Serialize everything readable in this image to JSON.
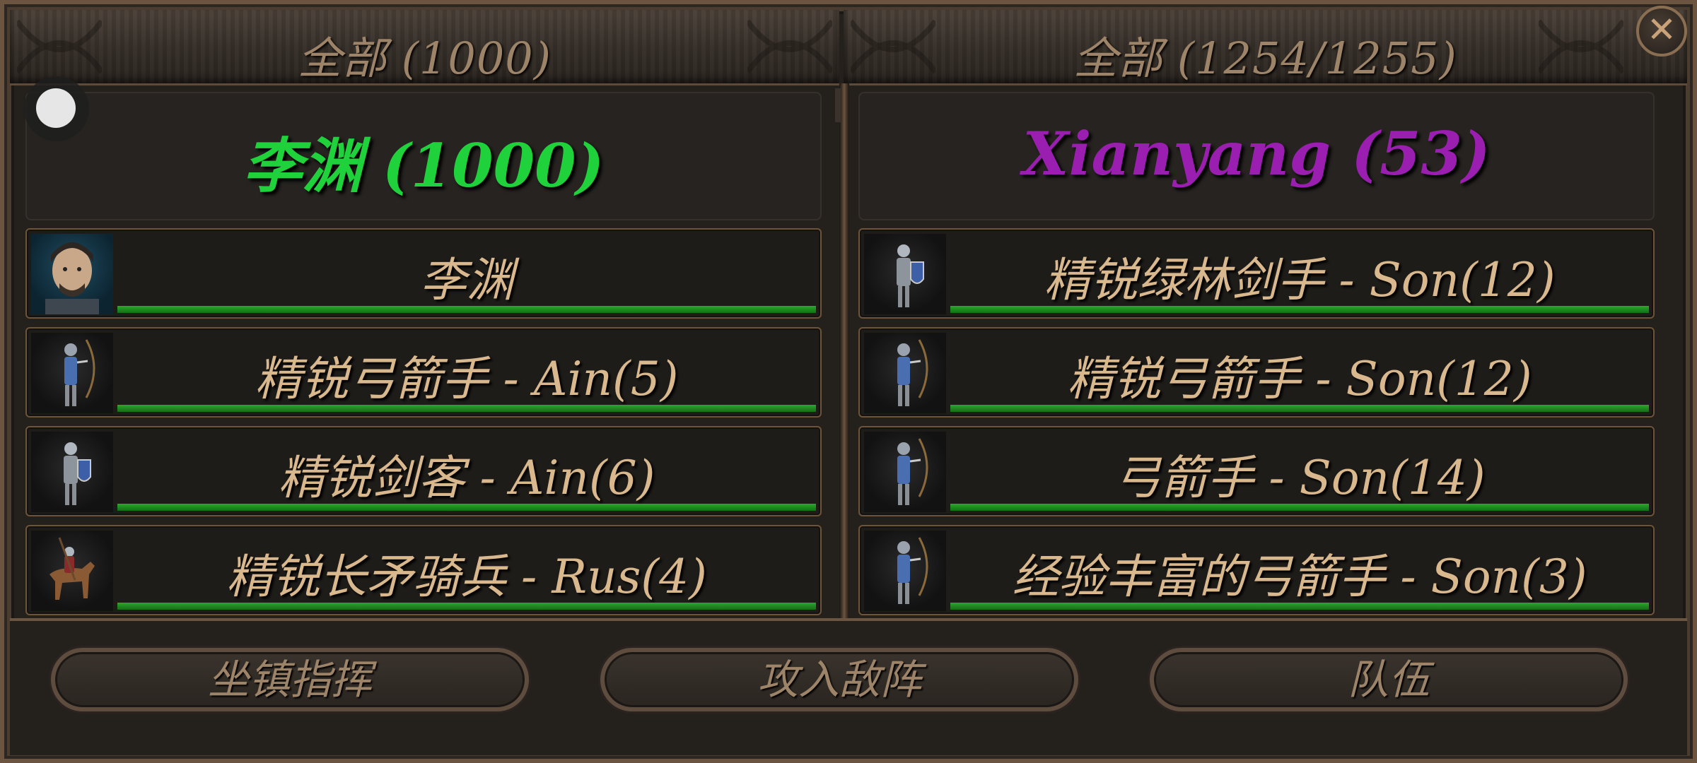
{
  "left_column": {
    "header": "全部 (1000)",
    "commander": {
      "name": "李渊 (1000)",
      "color": "#1fd13a"
    },
    "units": [
      {
        "label": "李渊",
        "portrait": "hero-portrait-icon",
        "health": 1.0
      },
      {
        "label": "精锐弓箭手 - Ain(5)",
        "portrait": "archer-icon",
        "health": 1.0
      },
      {
        "label": "精锐剑客 - Ain(6)",
        "portrait": "swordsman-icon",
        "health": 1.0
      },
      {
        "label": "精锐长矛骑兵 - Rus(4)",
        "portrait": "lancer-icon",
        "health": 1.0
      }
    ]
  },
  "right_column": {
    "header": "全部 (1254/1255)",
    "commander": {
      "name": "Xianyang (53)",
      "color": "#9a1fb0"
    },
    "units": [
      {
        "label": "精锐绿林剑手 - Son(12)",
        "portrait": "swordsman-icon",
        "health": 1.0
      },
      {
        "label": "精锐弓箭手 - Son(12)",
        "portrait": "archer-icon",
        "health": 1.0
      },
      {
        "label": "弓箭手 - Son(14)",
        "portrait": "archer-icon",
        "health": 1.0
      },
      {
        "label": "经验丰富的弓箭手 - Son(3)",
        "portrait": "archer-icon",
        "health": 1.0
      }
    ]
  },
  "buttons": {
    "hold": "坐镇指挥",
    "attack": "攻入敌阵",
    "party": "队伍"
  },
  "colors": {
    "health_bar": "#1f8a1f",
    "row_border": "#6d5338",
    "text": "#d9b88d"
  }
}
